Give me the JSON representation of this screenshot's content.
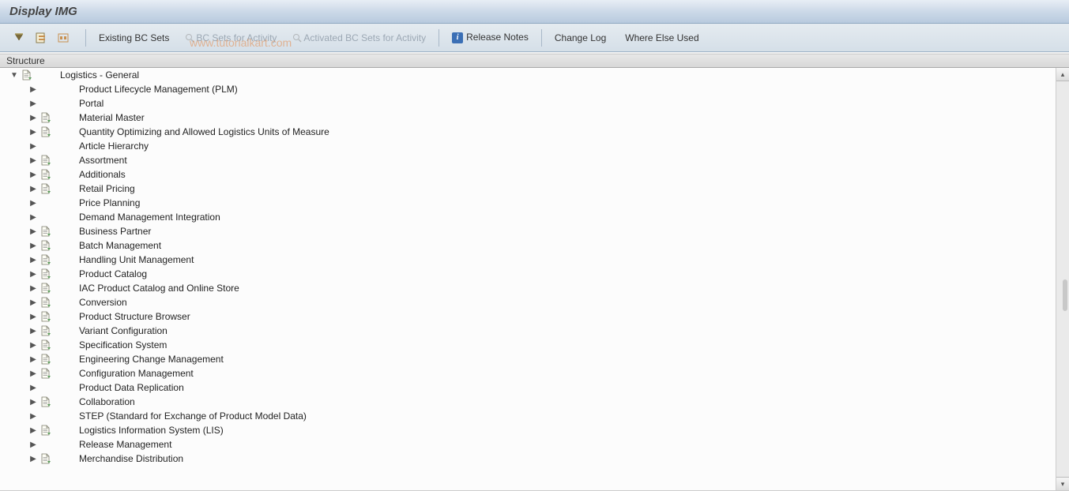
{
  "title": "Display IMG",
  "toolbar": {
    "existing_bc_sets": "Existing BC Sets",
    "bc_sets_for_activity": "BC Sets for Activity",
    "activated_bc_sets_for_activity": "Activated BC Sets for Activity",
    "release_notes": "Release Notes",
    "change_log": "Change Log",
    "where_else_used": "Where Else Used"
  },
  "structure_header": "Structure",
  "tree": {
    "root": {
      "label": "Logistics - General",
      "expanded": true,
      "has_doc": true
    },
    "items": [
      {
        "label": "Product Lifecycle Management (PLM)",
        "has_doc": false
      },
      {
        "label": "Portal",
        "has_doc": false
      },
      {
        "label": "Material Master",
        "has_doc": true
      },
      {
        "label": "Quantity Optimizing and Allowed Logistics Units of Measure",
        "has_doc": true
      },
      {
        "label": "Article Hierarchy",
        "has_doc": false
      },
      {
        "label": "Assortment",
        "has_doc": true
      },
      {
        "label": "Additionals",
        "has_doc": true
      },
      {
        "label": "Retail Pricing",
        "has_doc": true
      },
      {
        "label": "Price Planning",
        "has_doc": false
      },
      {
        "label": "Demand Management Integration",
        "has_doc": false
      },
      {
        "label": "Business Partner",
        "has_doc": true
      },
      {
        "label": "Batch Management",
        "has_doc": true
      },
      {
        "label": "Handling Unit Management",
        "has_doc": true
      },
      {
        "label": "Product Catalog",
        "has_doc": true
      },
      {
        "label": "IAC Product Catalog and Online Store",
        "has_doc": true
      },
      {
        "label": "Conversion",
        "has_doc": true
      },
      {
        "label": "Product Structure Browser",
        "has_doc": true
      },
      {
        "label": "Variant Configuration",
        "has_doc": true
      },
      {
        "label": "Specification System",
        "has_doc": true
      },
      {
        "label": "Engineering Change Management",
        "has_doc": true
      },
      {
        "label": "Configuration Management",
        "has_doc": true
      },
      {
        "label": "Product Data Replication",
        "has_doc": false
      },
      {
        "label": "Collaboration",
        "has_doc": true
      },
      {
        "label": "STEP (Standard for Exchange of Product Model Data)",
        "has_doc": false
      },
      {
        "label": "Logistics Information System (LIS)",
        "has_doc": true
      },
      {
        "label": "Release Management",
        "has_doc": false
      },
      {
        "label": "Merchandise Distribution",
        "has_doc": true
      }
    ]
  },
  "watermark": "www.tutorialkart.com"
}
